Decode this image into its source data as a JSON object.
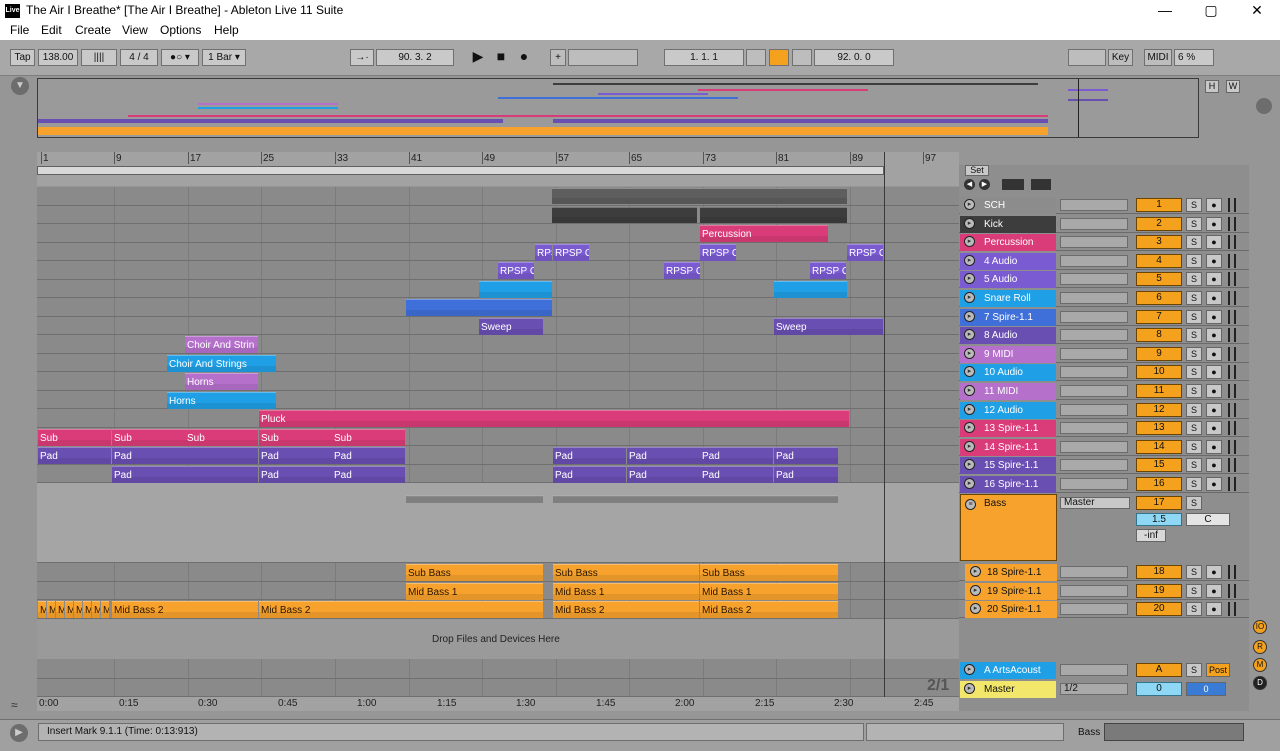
{
  "window": {
    "app_icon": "Live",
    "title": "The Air I Breathe*  [The Air I Breathe] - Ableton Live 11 Suite",
    "minimize": "—",
    "maximize": "▢",
    "close": "✕"
  },
  "menu": [
    "File",
    "Edit",
    "Create",
    "View",
    "Options",
    "Help"
  ],
  "control": {
    "tap": "Tap",
    "tempo": "138.00",
    "nudge": "||||",
    "meter": "4 / 4",
    "metronome": "●○ ▾",
    "quantize": "1 Bar ▾",
    "follow": "→·",
    "pos": "90.  3.  2",
    "play": "▶",
    "stop": "■",
    "rec": "●",
    "add": "+",
    "loop_pos": "1.  1.  1",
    "punch": "92.  0.  0",
    "key": "Key",
    "midi": "MIDI",
    "cpu": "6 %"
  },
  "overview": {
    "h": "H",
    "w": "W"
  },
  "ruler": {
    "bars": [
      "1",
      "9",
      "17",
      "25",
      "33",
      "41",
      "49",
      "57",
      "65",
      "73",
      "81",
      "89",
      "97"
    ]
  },
  "set_button": "Set",
  "tracks": [
    {
      "name": "SCH",
      "num": "1",
      "color": "#8c8c8c"
    },
    {
      "name": "Kick",
      "num": "2",
      "color": "#3d3d3d"
    },
    {
      "name": "Percussion",
      "num": "3",
      "color": "#d93c78"
    },
    {
      "name": "4 Audio",
      "num": "4",
      "color": "#7a5bd1"
    },
    {
      "name": "5 Audio",
      "num": "5",
      "color": "#7a5bd1"
    },
    {
      "name": "Snare Roll",
      "num": "6",
      "color": "#1f9fe5"
    },
    {
      "name": "7 Spire-1.1",
      "num": "7",
      "color": "#3f6fd8"
    },
    {
      "name": "8 Audio",
      "num": "8",
      "color": "#6a4fb3"
    },
    {
      "name": "9 MIDI",
      "num": "9",
      "color": "#b570cc"
    },
    {
      "name": "10 Audio",
      "num": "10",
      "color": "#1f9fe5"
    },
    {
      "name": "11 MIDI",
      "num": "11",
      "color": "#b570cc"
    },
    {
      "name": "12 Audio",
      "num": "12",
      "color": "#1f9fe5"
    },
    {
      "name": "13 Spire-1.1",
      "num": "13",
      "color": "#d93c78"
    },
    {
      "name": "14 Spire-1.1",
      "num": "14",
      "color": "#d93c78"
    },
    {
      "name": "15 Spire-1.1",
      "num": "15",
      "color": "#6a4fb3"
    },
    {
      "name": "16 Spire-1.1",
      "num": "16",
      "color": "#6a4fb3"
    }
  ],
  "bass_group": {
    "name": "Bass",
    "route": "Master",
    "num": "17",
    "solo": "S",
    "vol": "1.5",
    "pan": "C",
    "inf": "-inf"
  },
  "bass_tracks": [
    {
      "name": "18 Spire-1.1",
      "num": "18"
    },
    {
      "name": "19 Spire-1.1",
      "num": "19"
    },
    {
      "name": "20 Spire-1.1",
      "num": "20"
    }
  ],
  "return_track": {
    "name": "A ArtsAcoust",
    "num": "A",
    "solo": "S",
    "post": "Post"
  },
  "master": {
    "name": "Master",
    "route": "1/2",
    "num": "0",
    "vol": "0"
  },
  "clips": {
    "percussion": "Percussion",
    "rpsp": "RPSP C",
    "rps": "RPS",
    "sweep": "Sweep",
    "choir1": "Choir And Strin",
    "choir2": "Choir And Strings",
    "horns": "Horns",
    "pluck": "Pluck",
    "sub": "Sub",
    "pad": "Pad",
    "sub_bass": "Sub Bass",
    "mid_bass1": "Mid Bass 1",
    "mid_bass2": "Mid Bass 2",
    "m": "M"
  },
  "drop_hint": "Drop Files and Devices Here",
  "time_labels": [
    "0:00",
    "0:15",
    "0:30",
    "0:45",
    "1:00",
    "1:15",
    "1:30",
    "1:45",
    "2:00",
    "2:15",
    "2:30",
    "2:45"
  ],
  "sig": "2/1",
  "status": "Insert Mark 9.1.1 (Time: 0:13:913)",
  "status_right": "Bass",
  "solo_label": "S"
}
